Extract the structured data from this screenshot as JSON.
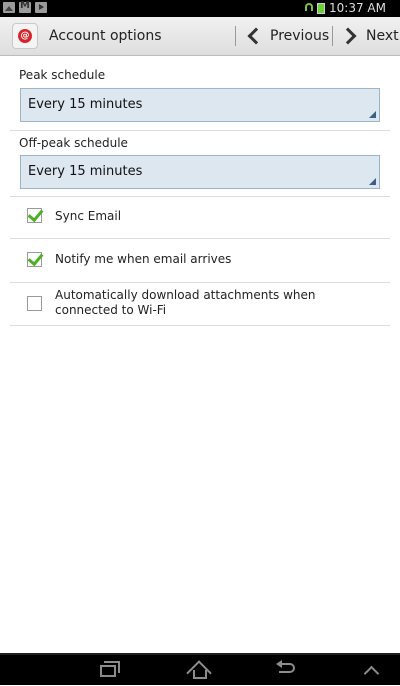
{
  "status_bar": {
    "time": "10:37 AM"
  },
  "action_bar": {
    "title": "Account options",
    "previous_label": "Previous",
    "next_label": "Next"
  },
  "peak_schedule": {
    "label": "Peak schedule",
    "value": "Every 15 minutes"
  },
  "offpeak_schedule": {
    "label": "Off-peak schedule",
    "value": "Every 15 minutes"
  },
  "options": [
    {
      "label": "Sync Email",
      "checked": true
    },
    {
      "label": "Notify me when email arrives",
      "checked": true
    },
    {
      "label": "Automatically download attachments when connected to Wi-Fi",
      "checked": false
    }
  ],
  "colors": {
    "accent": "#4caf24",
    "select_bg": "#dde7f0",
    "logo": "#d6262b"
  }
}
